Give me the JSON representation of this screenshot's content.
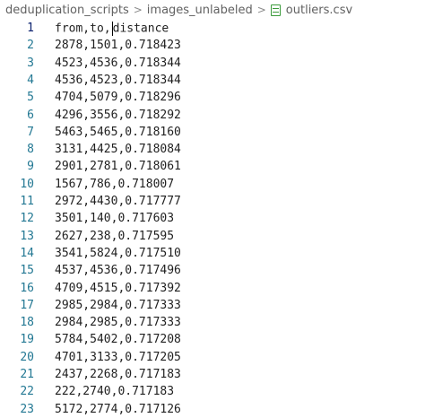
{
  "breadcrumb": {
    "items": [
      "deduplication_scripts",
      "images_unlabeled",
      "outliers.csv"
    ],
    "separator": ">"
  },
  "editor": {
    "lines": [
      {
        "num": "1",
        "text": "from,to,distance"
      },
      {
        "num": "2",
        "text": "2878,1501,0.718423"
      },
      {
        "num": "3",
        "text": "4523,4536,0.718344"
      },
      {
        "num": "4",
        "text": "4536,4523,0.718344"
      },
      {
        "num": "5",
        "text": "4704,5079,0.718296"
      },
      {
        "num": "6",
        "text": "4296,3556,0.718292"
      },
      {
        "num": "7",
        "text": "5463,5465,0.718160"
      },
      {
        "num": "8",
        "text": "3131,4425,0.718084"
      },
      {
        "num": "9",
        "text": "2901,2781,0.718061"
      },
      {
        "num": "10",
        "text": "1567,786,0.718007"
      },
      {
        "num": "11",
        "text": "2972,4430,0.717777"
      },
      {
        "num": "12",
        "text": "3501,140,0.717603"
      },
      {
        "num": "13",
        "text": "2627,238,0.717595"
      },
      {
        "num": "14",
        "text": "3541,5824,0.717510"
      },
      {
        "num": "15",
        "text": "4537,4536,0.717496"
      },
      {
        "num": "16",
        "text": "4709,4515,0.717392"
      },
      {
        "num": "17",
        "text": "2985,2984,0.717333"
      },
      {
        "num": "18",
        "text": "2984,2985,0.717333"
      },
      {
        "num": "19",
        "text": "5784,5402,0.717208"
      },
      {
        "num": "20",
        "text": "4701,3133,0.717205"
      },
      {
        "num": "21",
        "text": "2437,2268,0.717183"
      },
      {
        "num": "22",
        "text": "222,2740,0.717183"
      },
      {
        "num": "23",
        "text": "5172,2774,0.717126"
      }
    ]
  }
}
